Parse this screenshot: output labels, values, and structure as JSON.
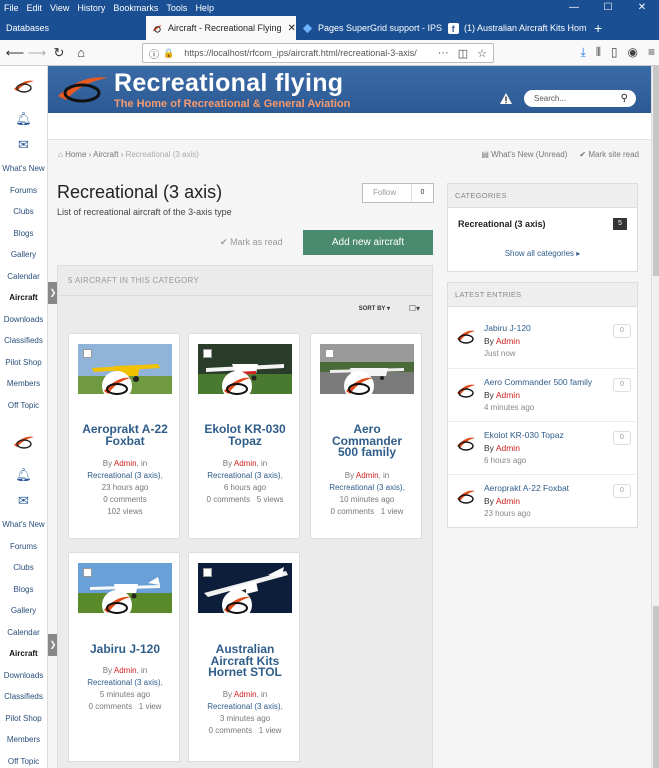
{
  "menu": [
    "File",
    "Edit",
    "View",
    "History",
    "Bookmarks",
    "Tools",
    "Help"
  ],
  "tabs": [
    {
      "label": "Databases"
    },
    {
      "label": "Aircraft - Recreational Flying"
    },
    {
      "label": "Pages SuperGrid support - IPS"
    },
    {
      "label": "(1) Australian Aircraft Kits Hom"
    }
  ],
  "url": "https://localhost/rfcom_ips/aircraft.html/recreational-3-axis/",
  "sidebar": [
    "What's New",
    "Forums",
    "Clubs",
    "Blogs",
    "Gallery",
    "Calendar",
    "Aircraft",
    "Downloads",
    "Classifieds",
    "Pilot Shop",
    "Members",
    "Off Topic"
  ],
  "banner": {
    "title": "Recreational flying",
    "subtitle": "The Home of Recreational & General Aviation",
    "search_placeholder": "Search..."
  },
  "breadcrumb": {
    "home": "Home",
    "aircraft": "Aircraft",
    "current": "Recreational (3 axis)"
  },
  "toplinks": {
    "whats_new": "What's New (Unread)",
    "mark_read": "Mark site read"
  },
  "category": {
    "title": "Recreational (3 axis)",
    "description": "List of recreational aircraft of the 3-axis type",
    "follow_label": "Follow",
    "follow_count": "0"
  },
  "actions": {
    "mark_as_read": "Mark as read",
    "add_new": "Add new aircraft"
  },
  "list": {
    "header": "5 AIRCRAFT IN THIS CATEGORY",
    "sort_by": "SORT BY",
    "cards": [
      {
        "title_lines": [
          "Aeroprakt A-22",
          "Foxbat"
        ],
        "by": "By",
        "author": "Admin",
        "in": ", in",
        "category": "Recreational (3 axis)",
        "time": "23 hours ago",
        "comments": "0 comments",
        "views": "102 views"
      },
      {
        "title_lines": [
          "Ekolot KR-030",
          "Topaz"
        ],
        "by": "By",
        "author": "Admin",
        "in": ", in",
        "category": "Recreational (3 axis)",
        "time": "6 hours ago",
        "comments": "0 comments",
        "views": "5 views"
      },
      {
        "title_lines": [
          "Aero",
          "Commander",
          "500 family"
        ],
        "by": "By",
        "author": "Admin",
        "in": ", in",
        "category": "Recreational (3 axis)",
        "time": "10 minutes ago",
        "comments": "0 comments",
        "views": "1 view"
      },
      {
        "title_lines": [
          "Jabiru J-120"
        ],
        "by": "By",
        "author": "Admin",
        "in": ", in",
        "category": "Recreational (3 axis)",
        "time": "5 minutes ago",
        "comments": "0 comments",
        "views": "1 view"
      },
      {
        "title_lines": [
          "Australian",
          "Aircraft Kits",
          "Hornet STOL"
        ],
        "by": "By",
        "author": "Admin",
        "in": ", in",
        "category": "Recreational (3 axis)",
        "time": "3 minutes ago",
        "comments": "0 comments",
        "views": "1 view"
      }
    ]
  },
  "categories_box": {
    "header": "CATEGORIES",
    "item": "Recreational (3 axis)",
    "count": "5",
    "show_all": "Show all categories"
  },
  "latest": {
    "header": "LATEST ENTRIES",
    "entries": [
      {
        "title": "Jabiru J-120",
        "by": "By",
        "author": "Admin",
        "time": "Just now",
        "count": "0"
      },
      {
        "title": "Aero Commander 500 family",
        "by": "By",
        "author": "Admin",
        "time": "4 minutes ago",
        "count": "0"
      },
      {
        "title": "Ekolot KR-030 Topaz",
        "by": "By",
        "author": "Admin",
        "time": "6 hours ago",
        "count": "0"
      },
      {
        "title": "Aeroprakt A-22 Foxbat",
        "by": "By",
        "author": "Admin",
        "time": "23 hours ago",
        "count": "0"
      }
    ]
  },
  "colors": {
    "brand_blue": "#2d5a94",
    "accent_orange": "#f59a6e",
    "button_green": "#4a8b6f",
    "link_blue": "#2f5d8a",
    "author_red": "#cc2222"
  }
}
